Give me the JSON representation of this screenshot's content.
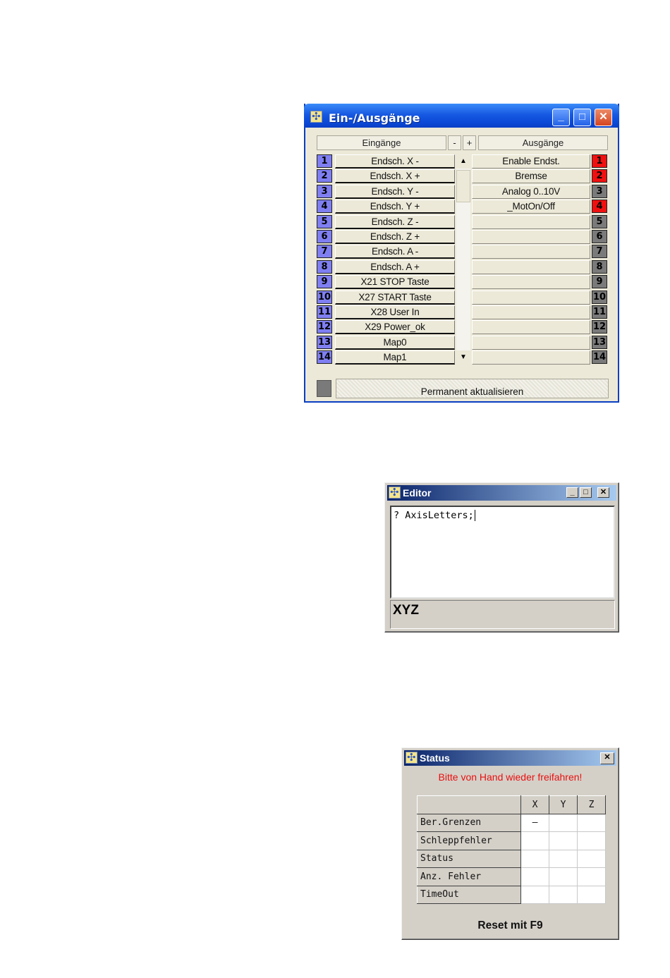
{
  "io_window": {
    "title": "Ein-/Ausgänge",
    "header": {
      "inputs": "Eingänge",
      "minus": "-",
      "plus": "+",
      "outputs": "Ausgänge"
    },
    "buttons": {
      "minimize": "_",
      "maximize": "□",
      "close": "✕"
    },
    "inputs": [
      {
        "num": "1",
        "label": "Endsch. X -"
      },
      {
        "num": "2",
        "label": "Endsch. X +"
      },
      {
        "num": "3",
        "label": "Endsch. Y -"
      },
      {
        "num": "4",
        "label": "Endsch. Y +"
      },
      {
        "num": "5",
        "label": "Endsch. Z -"
      },
      {
        "num": "6",
        "label": "Endsch. Z +"
      },
      {
        "num": "7",
        "label": "Endsch. A -"
      },
      {
        "num": "8",
        "label": "Endsch. A +"
      },
      {
        "num": "9",
        "label": "X21 STOP Taste"
      },
      {
        "num": "10",
        "label": "X27 START Taste"
      },
      {
        "num": "11",
        "label": "X28 User In"
      },
      {
        "num": "12",
        "label": "X29 Power_ok"
      },
      {
        "num": "13",
        "label": "Map0"
      },
      {
        "num": "14",
        "label": "Map1"
      }
    ],
    "outputs": [
      {
        "num": "1",
        "label": "Enable Endst.",
        "state": "on"
      },
      {
        "num": "2",
        "label": "Bremse",
        "state": "on"
      },
      {
        "num": "3",
        "label": "Analog 0..10V",
        "state": "off"
      },
      {
        "num": "4",
        "label": "_MotOn/Off",
        "state": "on"
      },
      {
        "num": "5",
        "label": "",
        "state": "off"
      },
      {
        "num": "6",
        "label": "",
        "state": "off"
      },
      {
        "num": "7",
        "label": "",
        "state": "off"
      },
      {
        "num": "8",
        "label": "",
        "state": "off"
      },
      {
        "num": "9",
        "label": "",
        "state": "off"
      },
      {
        "num": "10",
        "label": "",
        "state": "off"
      },
      {
        "num": "11",
        "label": "",
        "state": "off"
      },
      {
        "num": "12",
        "label": "",
        "state": "off"
      },
      {
        "num": "13",
        "label": "",
        "state": "off"
      },
      {
        "num": "14",
        "label": "",
        "state": "off"
      }
    ],
    "colors": {
      "input_led": "#7f7ff2",
      "output_on": "#f01010",
      "output_off": "#7a7a7a"
    },
    "permanent_button": "Permanent aktualisieren"
  },
  "editor_window": {
    "title": "Editor",
    "buttons": {
      "minimize": "_",
      "maximize": "□",
      "close": "✕"
    },
    "text": "? AxisLetters;",
    "result": "XYZ"
  },
  "status_window": {
    "title": "Status",
    "close": "✕",
    "message": "Bitte von Hand wieder freifahren!",
    "columns": [
      "X",
      "Y",
      "Z"
    ],
    "rows": [
      {
        "label": "Ber.Grenzen",
        "values": [
          "–",
          "",
          ""
        ]
      },
      {
        "label": "Schleppfehler",
        "values": [
          "",
          "",
          ""
        ]
      },
      {
        "label": "Status",
        "values": [
          "",
          "",
          ""
        ]
      },
      {
        "label": "Anz. Fehler",
        "values": [
          "",
          "",
          ""
        ]
      },
      {
        "label": "TimeOut",
        "values": [
          "",
          "",
          ""
        ]
      }
    ],
    "footer": "Reset mit F9"
  }
}
